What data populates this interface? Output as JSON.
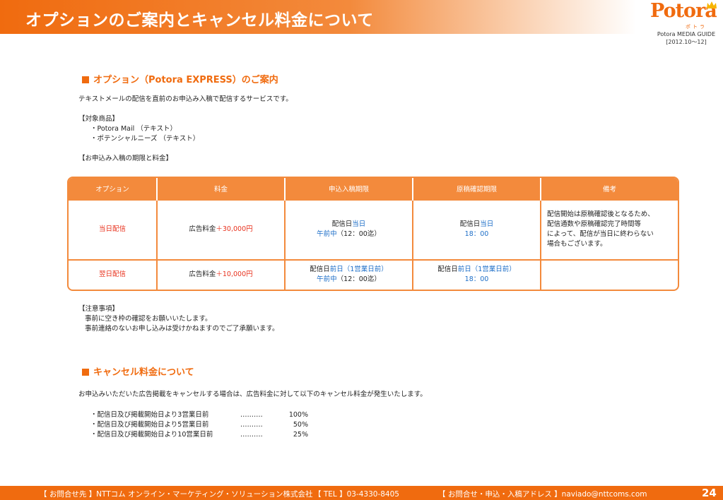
{
  "header": {
    "title": "オプションのご案内とキャンセル料金について",
    "logo_text": "Potora",
    "logo_sub": "ポトラ",
    "guide_line1": "Potora MEDIA GUIDE",
    "guide_line2": "[2012.10〜12]"
  },
  "section1": {
    "title": "オプション（Potora EXPRESS）のご案内",
    "intro": "テキストメールの配信を直前のお申込み入稿で配信するサービスです。",
    "target_heading": "【対象商品】",
    "target_items": [
      "・Potora Mail （テキスト）",
      "・ポテンシャルニーズ （テキスト）"
    ],
    "deadline_heading": "【お申込み入稿の期限と料金】"
  },
  "table": {
    "headers": [
      "オプション",
      "料金",
      "申込入稿期限",
      "原稿確認期限",
      "備考"
    ],
    "rows": [
      {
        "option": "当日配信",
        "price_label": "広告料金",
        "price_value": "＋30,000円",
        "apply_prefix": "配信日",
        "apply_day": "当日",
        "apply_time_colored": "午前中",
        "apply_time_rest": "（12：00迄）",
        "confirm_prefix": "配信日",
        "confirm_day": "当日",
        "confirm_time": "18：00",
        "note": [
          "配信開始は原稿確認後となるため、",
          "配信通数や原稿確認完了時間等",
          "によって、配信が当日に終わらない",
          "場合もございます。"
        ]
      },
      {
        "option": "翌日配信",
        "price_label": "広告料金",
        "price_value": "＋10,000円",
        "apply_prefix": "配信日",
        "apply_day": "前日（1営業日前）",
        "apply_time_colored": "午前中",
        "apply_time_rest": "（12：00迄）",
        "confirm_prefix": "配信日",
        "confirm_day": "前日（1営業日前）",
        "confirm_time": "18：00",
        "note": []
      }
    ]
  },
  "notes": {
    "heading": "【注意事項】",
    "lines": [
      "事前に空き枠の確認をお願いいたします。",
      "事前連絡のないお申し込みは受けかねますのでご了承願います。"
    ]
  },
  "section2": {
    "title": "キャンセル料金について",
    "intro": "お申込みいただいた広告掲載をキャンセルする場合は、広告料金に対して以下のキャンセル料金が発生いたします。",
    "items": [
      {
        "label": "・配信日及び掲載開始日より3営業日前",
        "dots": "‥‥‥‥‥",
        "value": "100%"
      },
      {
        "label": "・配信日及び掲載開始日より5営業日前",
        "dots": "‥‥‥‥‥",
        "value": "50%"
      },
      {
        "label": "・配信日及び掲載開始日より10営業日前",
        "dots": "‥‥‥‥‥",
        "value": "25%"
      }
    ]
  },
  "footer": {
    "contact": "【 お問合せ先 】NTTコム オンライン・マーケティング・ソリューション株式会社",
    "tel": "【 TEL 】03-4330-8405",
    "email": "【 お問合せ・申込・入稿アドレス 】naviado@nttcoms.com",
    "page_number": "24"
  },
  "colors": {
    "accent": "#f06b0f",
    "table_header": "#f38a3c",
    "red": "#e8321e",
    "blue": "#1e6fc8"
  }
}
